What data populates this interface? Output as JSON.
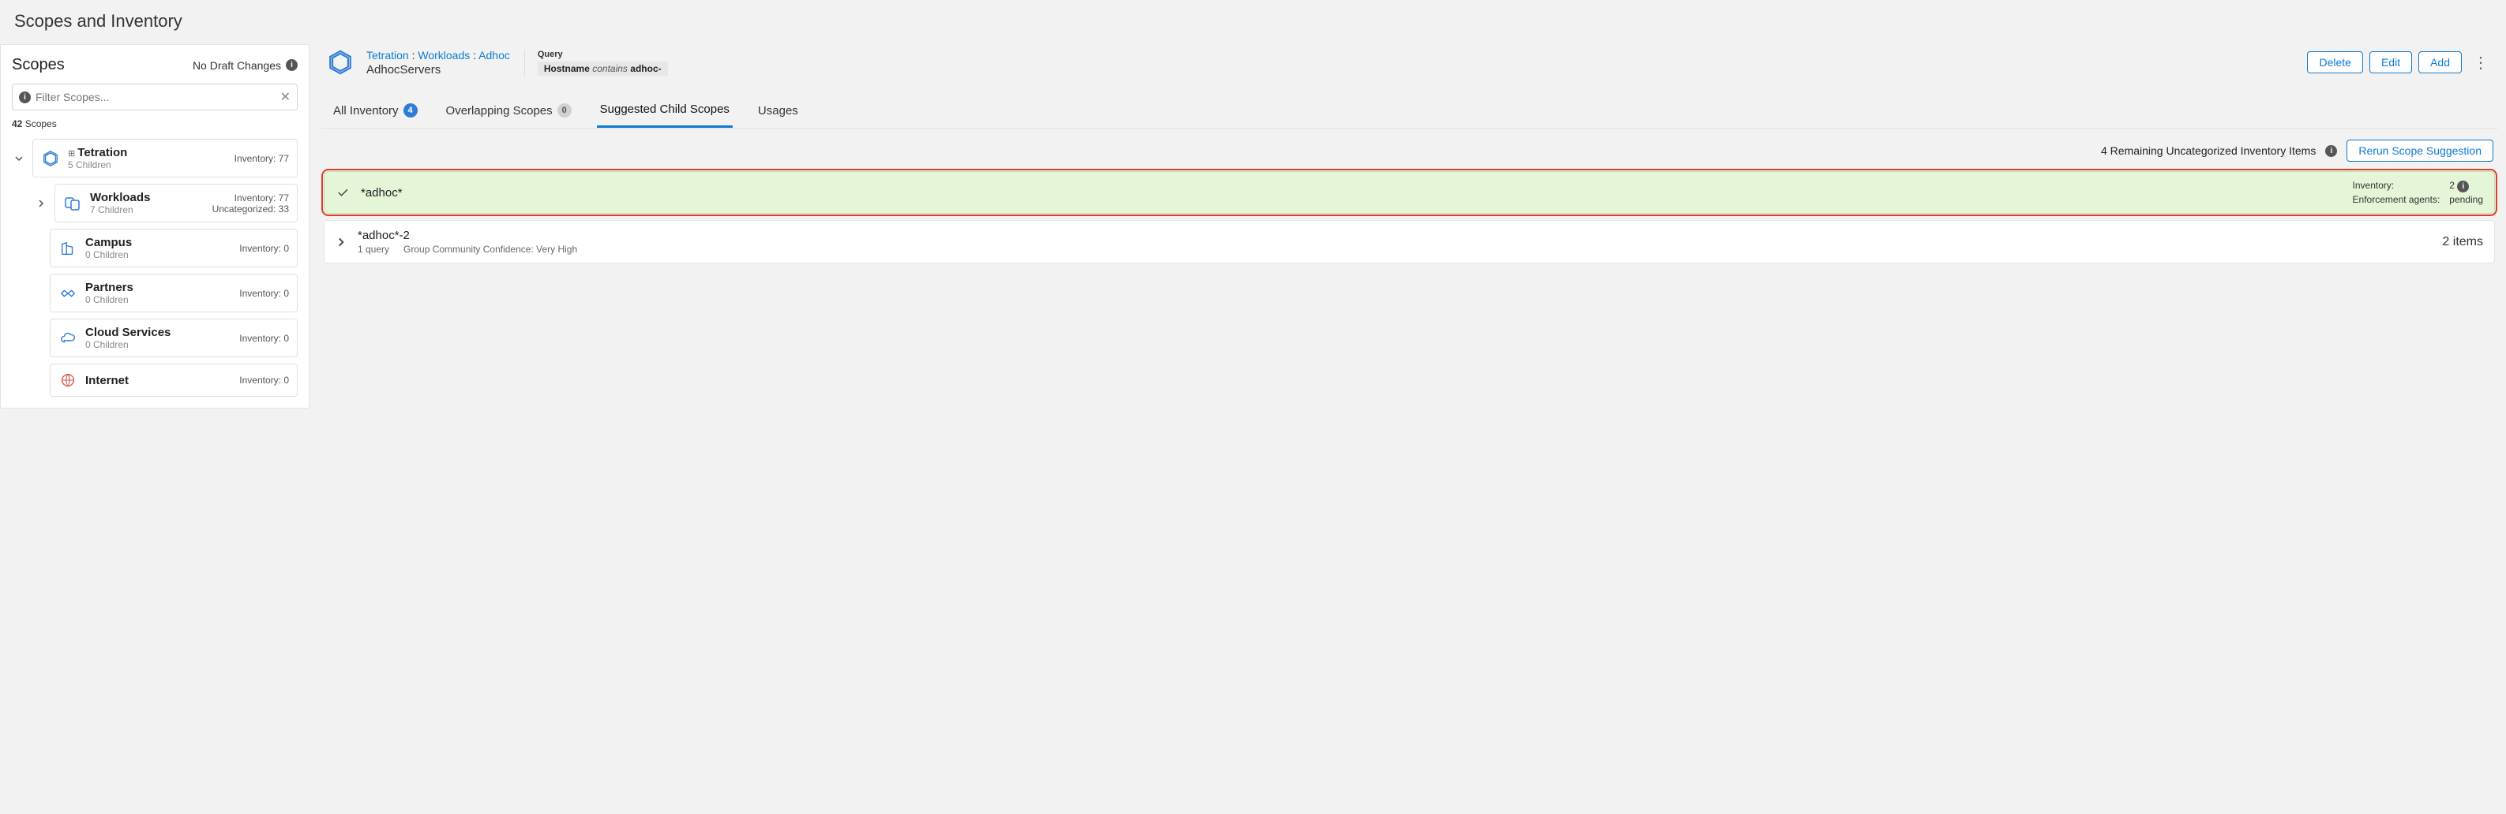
{
  "page_title": "Scopes and Inventory",
  "left": {
    "title": "Scopes",
    "no_draft": "No Draft Changes",
    "filter_placeholder": "Filter Scopes...",
    "count_value": "42",
    "count_label": "Scopes",
    "tree": {
      "root": {
        "name": "Tetration",
        "children": "5 Children",
        "inv": "Inventory: 77"
      },
      "workloads": {
        "name": "Workloads",
        "children": "7 Children",
        "inv": "Inventory: 77",
        "uncat": "Uncategorized: 33"
      },
      "campus": {
        "name": "Campus",
        "children": "0 Children",
        "inv": "Inventory: 0"
      },
      "partners": {
        "name": "Partners",
        "children": "0 Children",
        "inv": "Inventory: 0"
      },
      "cloud": {
        "name": "Cloud Services",
        "children": "0 Children",
        "inv": "Inventory: 0"
      },
      "internet": {
        "name": "Internet",
        "children_blank": "",
        "inv": "Inventory: 0"
      }
    }
  },
  "detail": {
    "crumbs": {
      "a": "Tetration",
      "b": "Workloads",
      "c": "Adhoc",
      "sep": " : "
    },
    "scope_name": "AdhocServers",
    "query_label": "Query",
    "query": {
      "field": "Hostname",
      "op": "contains",
      "value": "adhoc-"
    },
    "actions": {
      "delete": "Delete",
      "edit": "Edit",
      "add": "Add"
    },
    "tabs": {
      "all": "All Inventory",
      "all_badge": "4",
      "overlap": "Overlapping Scopes",
      "overlap_badge": "0",
      "suggested": "Suggested Child Scopes",
      "usages": "Usages"
    },
    "subbar": {
      "remaining": "4 Remaining Uncategorized Inventory Items",
      "rerun": "Rerun Scope Suggestion"
    },
    "card1": {
      "title": "*adhoc*",
      "inv_label": "Inventory:",
      "inv_value": "2",
      "enf_label": "Enforcement agents:",
      "enf_value": "pending"
    },
    "card2": {
      "title": "*adhoc*-2",
      "q": "1 query",
      "conf": "Group Community Confidence: Very High",
      "items": "2 items"
    }
  }
}
